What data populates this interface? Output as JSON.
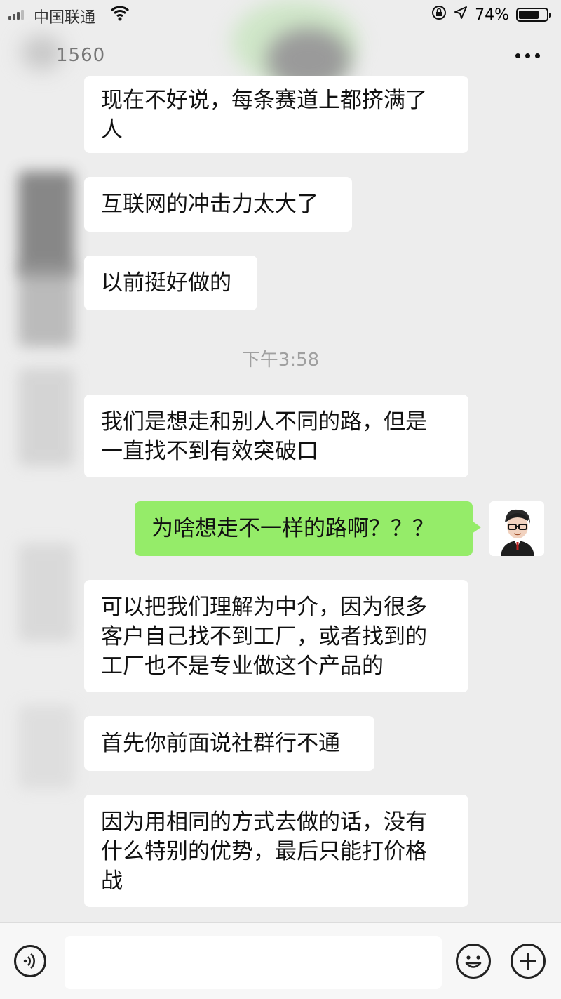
{
  "status_bar": {
    "carrier": "中国联通",
    "battery_percent_label": "74%",
    "battery_level": 0.74
  },
  "nav": {
    "title": "1560",
    "more_icon": "more-dots-icon"
  },
  "messages": [
    {
      "id": "m1",
      "side": "left",
      "text": "现在不好说，每条赛道上都挤满了\n人"
    },
    {
      "id": "m2",
      "side": "left",
      "text": "互联网的冲击力太大了"
    },
    {
      "id": "m3",
      "side": "left",
      "text": "以前挺好做的"
    },
    {
      "id": "m5",
      "side": "left",
      "text": "我们是想走和别人不同的路，但是\n一直找不到有效突破口"
    },
    {
      "id": "m6",
      "side": "right",
      "text": "为啥想走不一样的路啊？？？"
    },
    {
      "id": "m7",
      "side": "left",
      "text": "可以把我们理解为中介，因为很多\n客户自己找不到工厂，或者找到的\n工厂也不是专业做这个产品的"
    },
    {
      "id": "m8",
      "side": "left",
      "text": "首先你前面说社群行不通"
    },
    {
      "id": "m9",
      "side": "left",
      "text": "因为用相同的方式去做的话，没有\n什么特别的优势，最后只能打价格\n战"
    }
  ],
  "time_divider": "下午3:58",
  "input_bar": {
    "voice_icon": "voice-icon",
    "emoji_icon": "emoji-icon",
    "plus_icon": "plus-icon"
  },
  "colors": {
    "background": "#ededed",
    "my_bubble": "#95ec69",
    "their_bubble": "#ffffff",
    "time_text": "#a0a0a0"
  }
}
